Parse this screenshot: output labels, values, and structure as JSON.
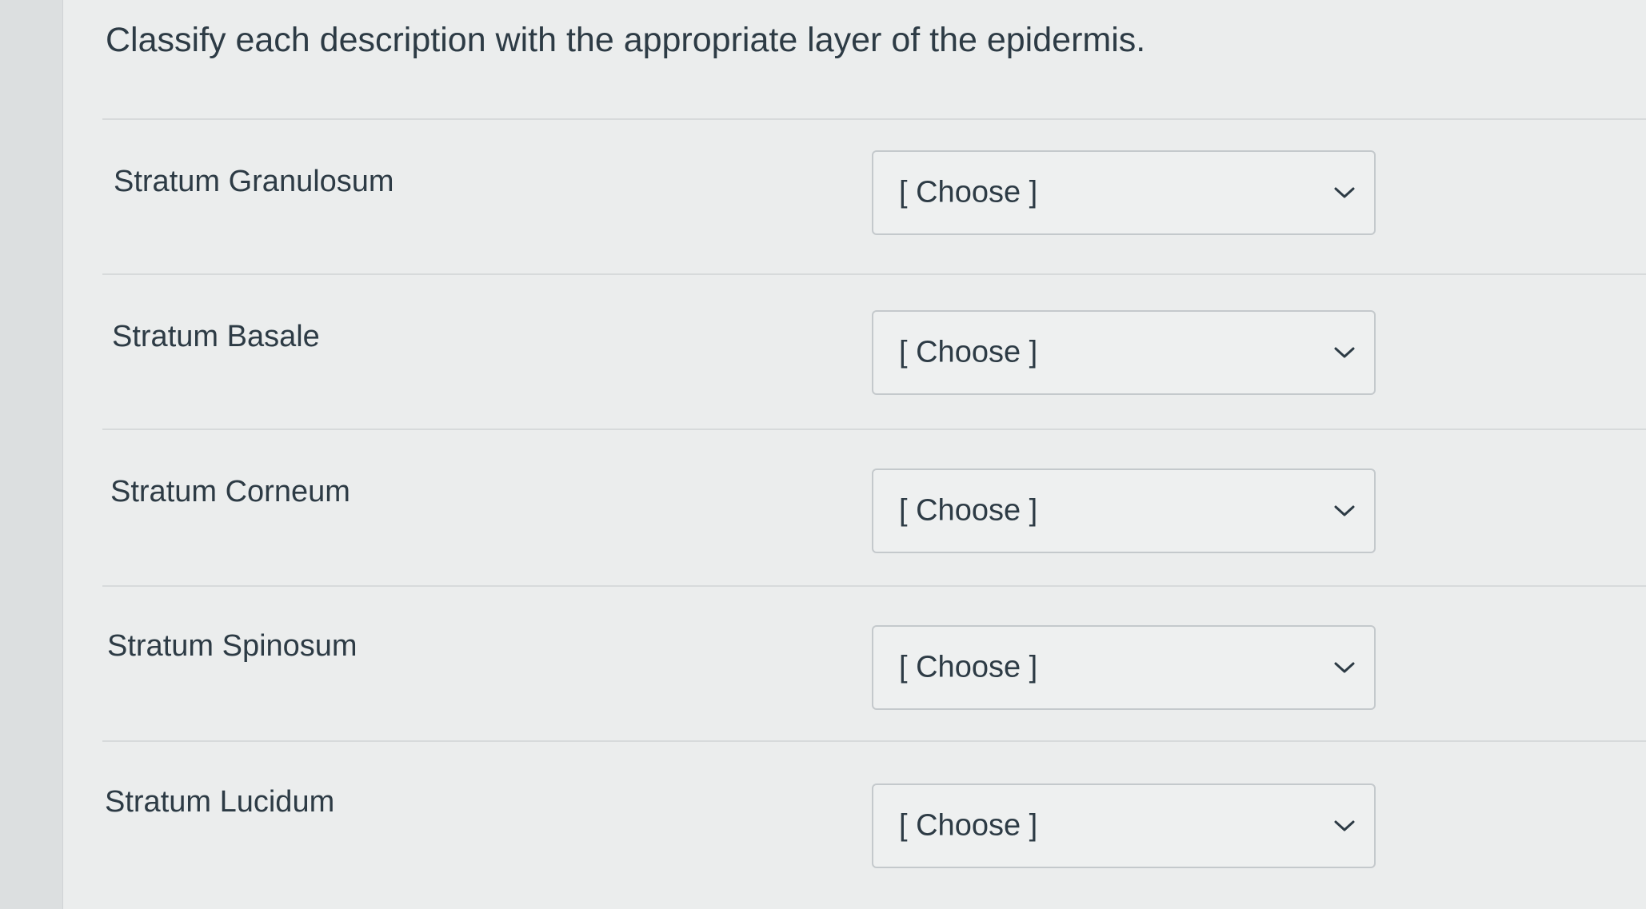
{
  "question": {
    "prompt": "Classify each description with the appropriate layer of the epidermis."
  },
  "rows": [
    {
      "label": "Stratum Granulosum",
      "selected": "[ Choose ]"
    },
    {
      "label": "Stratum Basale",
      "selected": "[ Choose ]"
    },
    {
      "label": "Stratum Corneum",
      "selected": "[ Choose ]"
    },
    {
      "label": "Stratum Spinosum",
      "selected": "[ Choose ]"
    },
    {
      "label": "Stratum Lucidum",
      "selected": "[ Choose ]"
    }
  ],
  "icons": {
    "dropdown": "chevron-down-icon"
  },
  "colors": {
    "text": "#2d3b45",
    "panel": "#ebeded",
    "border": "#c4c9cc"
  }
}
